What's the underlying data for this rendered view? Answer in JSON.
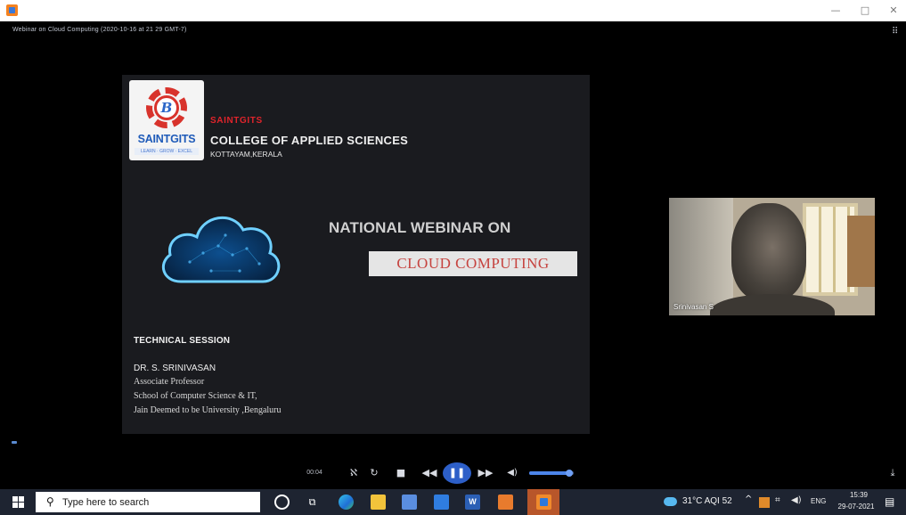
{
  "window": {
    "minimize_glyph": "—",
    "maximize_glyph": "□",
    "close_glyph": "✕"
  },
  "meeting": {
    "title": "Webinar on Cloud Computing (2020-10-16 at 21 29 GMT-7)"
  },
  "slide": {
    "logo": {
      "symbol": "B",
      "name": "SAINTGITS",
      "tagline": "LEARN · GROW · EXCEL"
    },
    "institution_short": "SAINTGITS",
    "institution_full": "COLLEGE OF APPLIED SCIENCES",
    "institution_place": "KOTTAYAM,KERALA",
    "webinar_label": "NATIONAL WEBINAR ON",
    "topic": "CLOUD COMPUTING",
    "session_label": "TECHNICAL SESSION",
    "speaker": {
      "name": "DR. S. SRINIVASAN",
      "designation": "Associate Professor",
      "department": "School of Computer Science & IT,",
      "university": "Jain Deemed to be University ,Bengaluru"
    }
  },
  "participant": {
    "name": "Srinivasan S"
  },
  "player": {
    "elapsed": "00:04",
    "skip_glyph": "ℵ",
    "loop_glyph": "↻",
    "stop_glyph": "■",
    "rewind_glyph": "◀◀",
    "pause_glyph": "❚❚",
    "forward_glyph": "▶▶",
    "volume_glyph": "◀)",
    "volume_level": 0.9,
    "collapse_glyph": "⤓"
  },
  "taskbar": {
    "search_placeholder": "Type here to search",
    "taskview_glyph": "⧉",
    "word_letter": "W",
    "weather": "31°C  AQI 52",
    "chevron_glyph": "^",
    "network_glyph": "⌗",
    "volume_glyph": "◀)",
    "language": "ENG",
    "time": "15:39",
    "date": "29-07-2021",
    "notification_glyph": "▤"
  },
  "icons": {
    "app": "ms-stream-icon",
    "search": "search-icon",
    "start": "windows-start-icon"
  },
  "colors": {
    "accent": "#2d5fc8",
    "brand_red": "#e0242b",
    "taskbar": "#1e2431"
  }
}
